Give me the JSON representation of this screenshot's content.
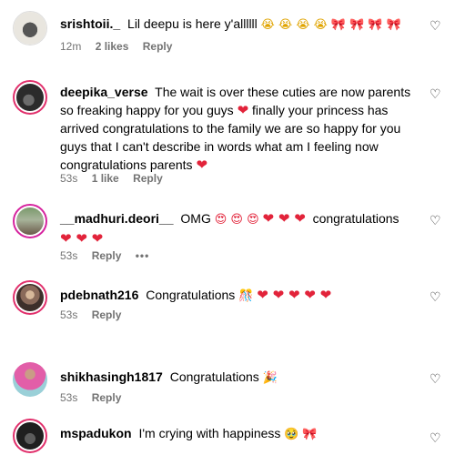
{
  "comments": [
    {
      "username": "srishtoii._",
      "text": "Lil deepu is here y'allllll",
      "time": "12m",
      "likes": "2 likes",
      "reply": "Reply"
    },
    {
      "username": "deepika_verse",
      "text1": "The wait is over these cuties are now parents so freaking happy for you guys",
      "text2": "finally your princess has arrived congratulations to the family we are so happy for you guys that I can't describe in words what am I feeling now congratulations parents",
      "time": "53s",
      "likes": "1 like",
      "reply": "Reply"
    },
    {
      "username": "__madhuri.deori__",
      "text1": "OMG",
      "text2": "congratulations",
      "time": "53s",
      "reply": "Reply",
      "more": "•••"
    },
    {
      "username": "pdebnath216",
      "text": "Congratulations",
      "time": "53s",
      "reply": "Reply"
    },
    {
      "username": "shikhasingh1817",
      "text": "Congratulations",
      "time": "53s",
      "reply": "Reply"
    },
    {
      "username": "mspadukon",
      "text": "I'm crying with happiness"
    }
  ],
  "icons": {
    "heart_outline": "♡",
    "heart_red": "❤",
    "bow": "🎀",
    "love_eyes": "😍",
    "crying": "😭",
    "party": "🎉",
    "confetti": "🎊",
    "tearful": "🥹"
  },
  "colors": {
    "meta": "#737373",
    "heart": "#e2233a",
    "ring": "#e1306c"
  }
}
